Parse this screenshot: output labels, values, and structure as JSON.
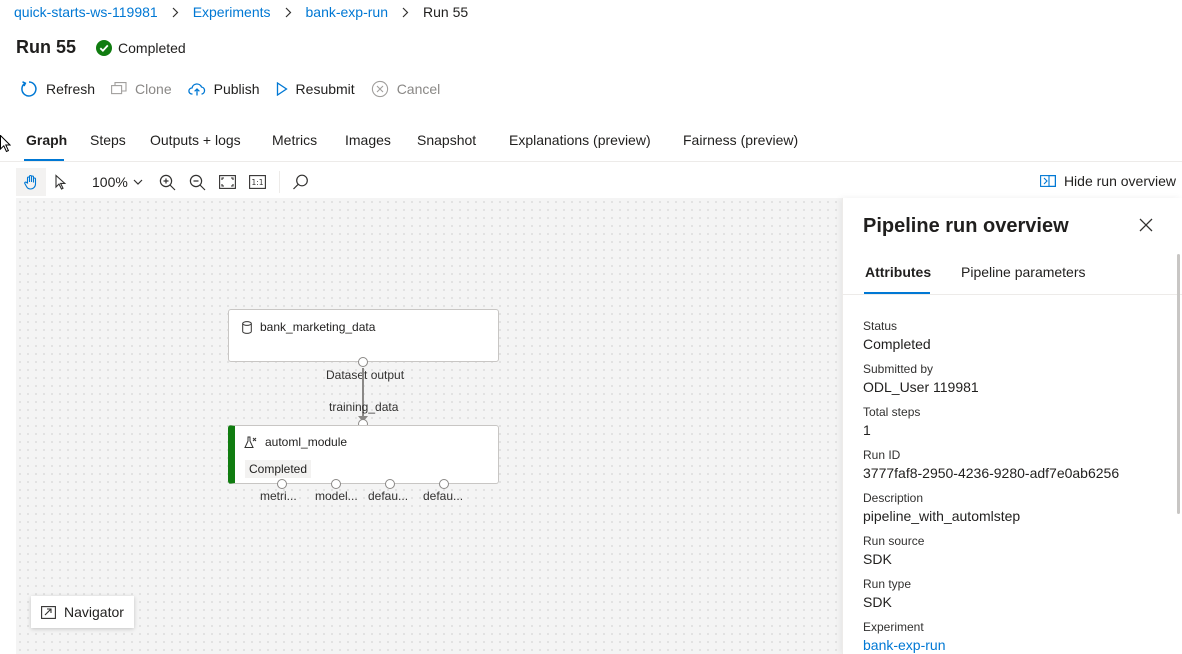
{
  "breadcrumb": {
    "items": [
      {
        "label": "quick-starts-ws-119981"
      },
      {
        "label": "Experiments"
      },
      {
        "label": "bank-exp-run"
      }
    ],
    "current": "Run 55"
  },
  "header": {
    "title": "Run 55",
    "status": "Completed",
    "status_color": "#107c10"
  },
  "commands": {
    "refresh": "Refresh",
    "clone": "Clone",
    "publish": "Publish",
    "resubmit": "Resubmit",
    "cancel": "Cancel"
  },
  "tabs": [
    {
      "label": "Graph"
    },
    {
      "label": "Steps"
    },
    {
      "label": "Outputs + logs"
    },
    {
      "label": "Metrics"
    },
    {
      "label": "Images"
    },
    {
      "label": "Snapshot"
    },
    {
      "label": "Explanations (preview)"
    },
    {
      "label": "Fairness (preview)"
    }
  ],
  "toolbar": {
    "zoom": "100%",
    "hide_overview": "Hide run overview",
    "fit_label": "1:1"
  },
  "graph": {
    "dataset_node": {
      "name": "bank_marketing_data",
      "output_label": "Dataset output"
    },
    "edge_label": "training_data",
    "module_node": {
      "name": "automl_module",
      "status": "Completed",
      "status_color": "#107c10",
      "outputs": [
        "metri...",
        "model...",
        "defau...",
        "defau..."
      ]
    },
    "navigator": "Navigator"
  },
  "panel": {
    "title": "Pipeline run overview",
    "tabs": [
      {
        "label": "Attributes"
      },
      {
        "label": "Pipeline parameters"
      }
    ],
    "attributes": [
      {
        "label": "Status",
        "value": "Completed"
      },
      {
        "label": "Submitted by",
        "value": "ODL_User 119981"
      },
      {
        "label": "Total steps",
        "value": "1"
      },
      {
        "label": "Run ID",
        "value": "3777faf8-2950-4236-9280-adf7e0ab6256"
      },
      {
        "label": "Description",
        "value": "pipeline_with_automlstep"
      },
      {
        "label": "Run source",
        "value": "SDK"
      },
      {
        "label": "Run type",
        "value": "SDK"
      },
      {
        "label": "Experiment",
        "value": "bank-exp-run"
      }
    ]
  },
  "colors": {
    "accent": "#0078d4",
    "success": "#107c10"
  }
}
